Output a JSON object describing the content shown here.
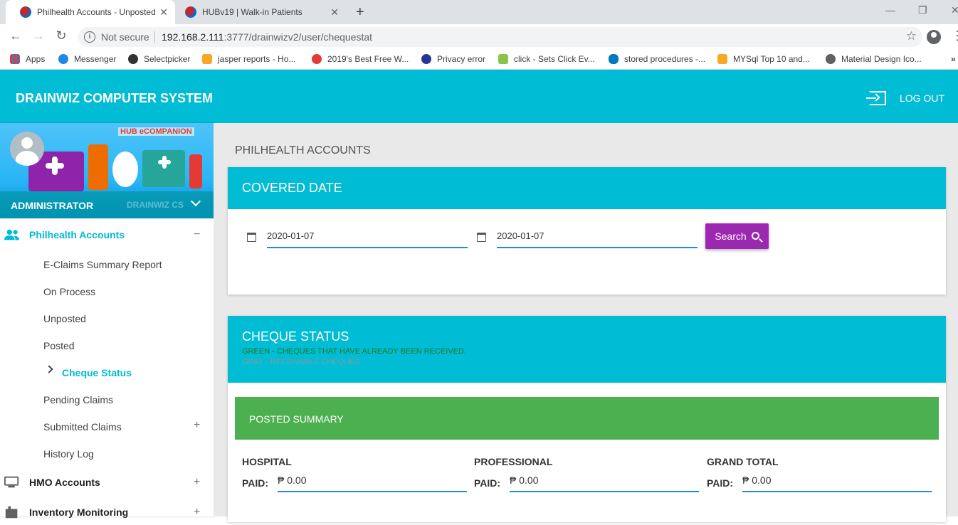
{
  "browser": {
    "tabs": [
      {
        "title": "Philhealth Accounts - Unposted",
        "active": true
      },
      {
        "title": "HUBv19 | Walk-in Patients",
        "active": false
      }
    ],
    "omnibox": {
      "security": "Not secure",
      "host": "192.168.2.111",
      "path": ":3777/drainwizv2/user/chequestat"
    },
    "bookmarks": [
      "Apps",
      "Messenger",
      "Selectpicker",
      "jasper reports - Ho...",
      "2019's Best Free W...",
      "Privacy error",
      "click - Sets Click Ev...",
      "stored procedures -...",
      "MYSql Top 10 and...",
      "Material Design Ico..."
    ]
  },
  "header": {
    "title": "DRAINWIZ COMPUTER SYSTEM",
    "logout": "LOG OUT"
  },
  "sidebar": {
    "brand_tag": "HUB eCOMPANION",
    "brand_faint": "DRAINWIZ CS",
    "role": "ADMINISTRATOR",
    "groups": [
      {
        "label": "Philhealth Accounts",
        "toggle": "−"
      },
      {
        "label": "HMO Accounts",
        "toggle": "+"
      },
      {
        "label": "Inventory Monitoring",
        "toggle": "+"
      }
    ],
    "items": [
      "E-Claims Summary Report",
      "On Process",
      "Unposted",
      "Posted",
      "Cheque Status",
      "Pending Claims",
      "Submitted Claims",
      "History Log"
    ],
    "submitted_toggle": "+"
  },
  "main": {
    "page_title": "PHILHEALTH ACCOUNTS",
    "covered": {
      "title": "COVERED DATE",
      "from": "2020-01-07",
      "to": "2020-01-07",
      "search": "Search"
    },
    "cheque": {
      "title": "CHEQUE STATUS",
      "legend_green": "GREEN - CHEQUES THAT HAVE ALREADY BEEN RECEIVED.",
      "legend_gray": "GRAY - RECEIVABLE CHEQUES.",
      "posted_title": "POSTED SUMMARY",
      "columns": [
        {
          "heading": "HOSPITAL",
          "paid_label": "PAID:",
          "value": "₱ 0.00"
        },
        {
          "heading": "PROFESSIONAL",
          "paid_label": "PAID:",
          "value": "₱ 0.00"
        },
        {
          "heading": "GRAND TOTAL",
          "paid_label": "PAID:",
          "value": "₱ 0.00"
        }
      ]
    }
  },
  "colors": {
    "primary": "#00bcd4",
    "accent": "#9c27b0",
    "success": "#4caf50",
    "legend_green": "#1b7a1b",
    "legend_gray": "#7e9da3"
  }
}
